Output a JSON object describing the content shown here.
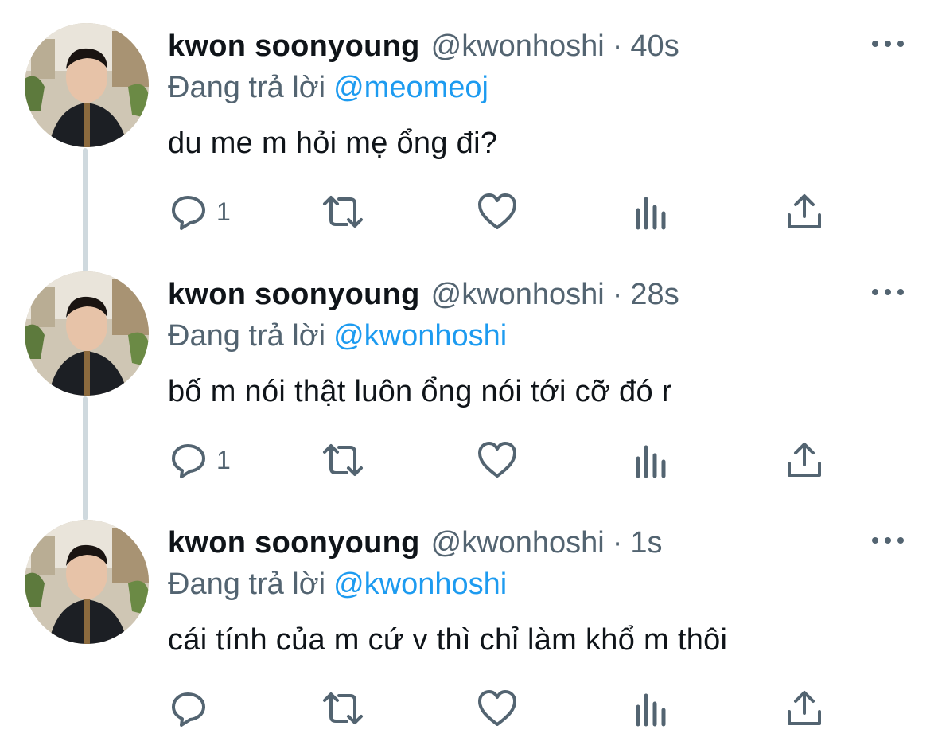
{
  "tweets": [
    {
      "name": "kwon soonyoung",
      "handle": "@kwonhoshi",
      "separator": "·",
      "time": "40s",
      "reply_prefix": "Đang trả lời",
      "reply_to": "@meomeoj",
      "text": "du me m hỏi mẹ ổng đi?",
      "reply_count": "1"
    },
    {
      "name": "kwon soonyoung",
      "handle": "@kwonhoshi",
      "separator": "·",
      "time": "28s",
      "reply_prefix": "Đang trả lời",
      "reply_to": "@kwonhoshi",
      "text": "bố m nói thật luôn ổng nói tới cỡ đó r",
      "reply_count": "1"
    },
    {
      "name": "kwon soonyoung",
      "handle": "@kwonhoshi",
      "separator": "·",
      "time": "1s",
      "reply_prefix": "Đang trả lời",
      "reply_to": "@kwonhoshi",
      "text": "cái tính của m cứ v thì chỉ làm khổ m thôi",
      "reply_count": ""
    }
  ],
  "icons": {
    "reply": "reply-icon",
    "retweet": "retweet-icon",
    "like": "heart-icon",
    "views": "analytics-icon",
    "share": "share-icon",
    "more": "more-icon"
  },
  "colors": {
    "text": "#0f1419",
    "secondary": "#536471",
    "link": "#1d9bf0",
    "thread_line": "#cfd9de"
  }
}
